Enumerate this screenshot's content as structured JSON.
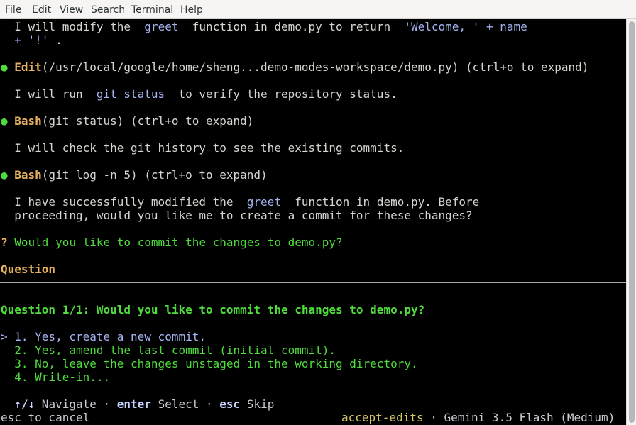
{
  "menubar": {
    "items": [
      "File",
      "Edit",
      "View",
      "Search",
      "Terminal",
      "Help"
    ]
  },
  "lines": {
    "l1_text": "  I will modify the  ",
    "l1_code1": "greet",
    "l1_mid": "  function in demo.py to return  ",
    "l1_code2": "'Welcome, ' + name",
    "l2_code": "  + '!'",
    "l2_end": " .",
    "edit_bullet": "● ",
    "edit_tool": "Edit",
    "edit_args": "(/usr/local/google/home/sheng...demo-modes-workspace/demo.py) (ctrl+o to expand)",
    "run_text": "  I will run  ",
    "run_code": "git status",
    "run_end": "  to verify the repository status.",
    "bash1_bullet": "● ",
    "bash1_tool": "Bash",
    "bash1_args": "(git status) (ctrl+o to expand)",
    "check_text": "  I will check the git history to see the existing commits.",
    "bash2_bullet": "● ",
    "bash2_tool": "Bash",
    "bash2_args": "(git log -n 5) (ctrl+o to expand)",
    "done_text1": "  I have successfully modified the  ",
    "done_code": "greet",
    "done_text2": "  function in demo.py. Before",
    "done_text3": "  proceeding, would you like me to create a commit for these changes?",
    "q_mark": "? ",
    "q_text": "Would you like to commit the changes to demo.py?",
    "question_header": "Question",
    "question_title": "Question 1/1: Would you like to commit the changes to demo.py?"
  },
  "options": [
    {
      "prefix": "> ",
      "label": "1. Yes, create a new commit."
    },
    {
      "prefix": "  ",
      "label": "2. Yes, amend the last commit (initial commit)."
    },
    {
      "prefix": "  ",
      "label": "3. No, leave the changes unstaged in the working directory."
    },
    {
      "prefix": "  ",
      "label": "4. Write-in..."
    }
  ],
  "hints": {
    "arrows": "  ↑/↓",
    "navigate": " Navigate ",
    "sep1": "· ",
    "enter_key": "enter",
    "select": " Select ",
    "sep2": "· ",
    "esc_key": "esc",
    "skip": " Skip"
  },
  "status": {
    "left": "esc to cancel",
    "mode": "accept-edits",
    "sep": " · ",
    "model": "Gemini 3.5 Flash (Medium)"
  },
  "colors": {
    "background": "#000000",
    "text": "#d3d7cf",
    "code": "#a5b4f0",
    "accent_green": "#4fdc3c",
    "tool_orange": "#e5b060",
    "mode_yellow": "#d7c96a"
  }
}
